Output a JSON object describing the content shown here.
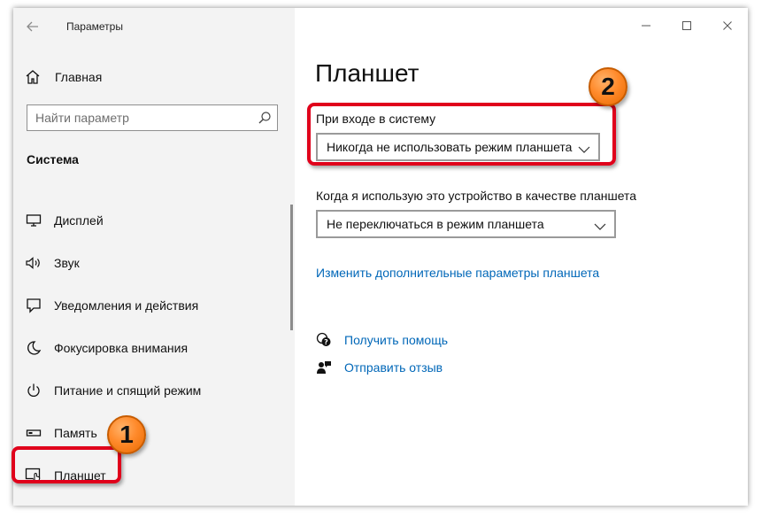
{
  "app": {
    "title": "Параметры"
  },
  "sidebar": {
    "home_label": "Главная",
    "search_placeholder": "Найти параметр",
    "section": "Система",
    "items": [
      {
        "label": "Дисплей",
        "icon": "monitor-icon"
      },
      {
        "label": "Звук",
        "icon": "speaker-icon"
      },
      {
        "label": "Уведомления и действия",
        "icon": "notification-icon"
      },
      {
        "label": "Фокусировка внимания",
        "icon": "moon-icon"
      },
      {
        "label": "Питание и спящий режим",
        "icon": "power-icon"
      },
      {
        "label": "Память",
        "icon": "storage-icon"
      },
      {
        "label": "Планшет",
        "icon": "tablet-icon",
        "selected": true
      }
    ]
  },
  "content": {
    "title": "Планшет",
    "signin_label": "При входе в систему",
    "signin_value": "Никогда не использовать режим планшета",
    "use_as_tablet_label": "Когда я использую это устройство в качестве планшета",
    "use_as_tablet_value": "Не переключаться в режим планшета",
    "advanced_link": "Изменить дополнительные параметры планшета",
    "help_link": "Получить помощь",
    "feedback_link": "Отправить отзыв"
  },
  "annotations": {
    "badge1": "1",
    "badge2": "2",
    "color": "#e0001b",
    "badge_color": "#ff8a2b"
  }
}
